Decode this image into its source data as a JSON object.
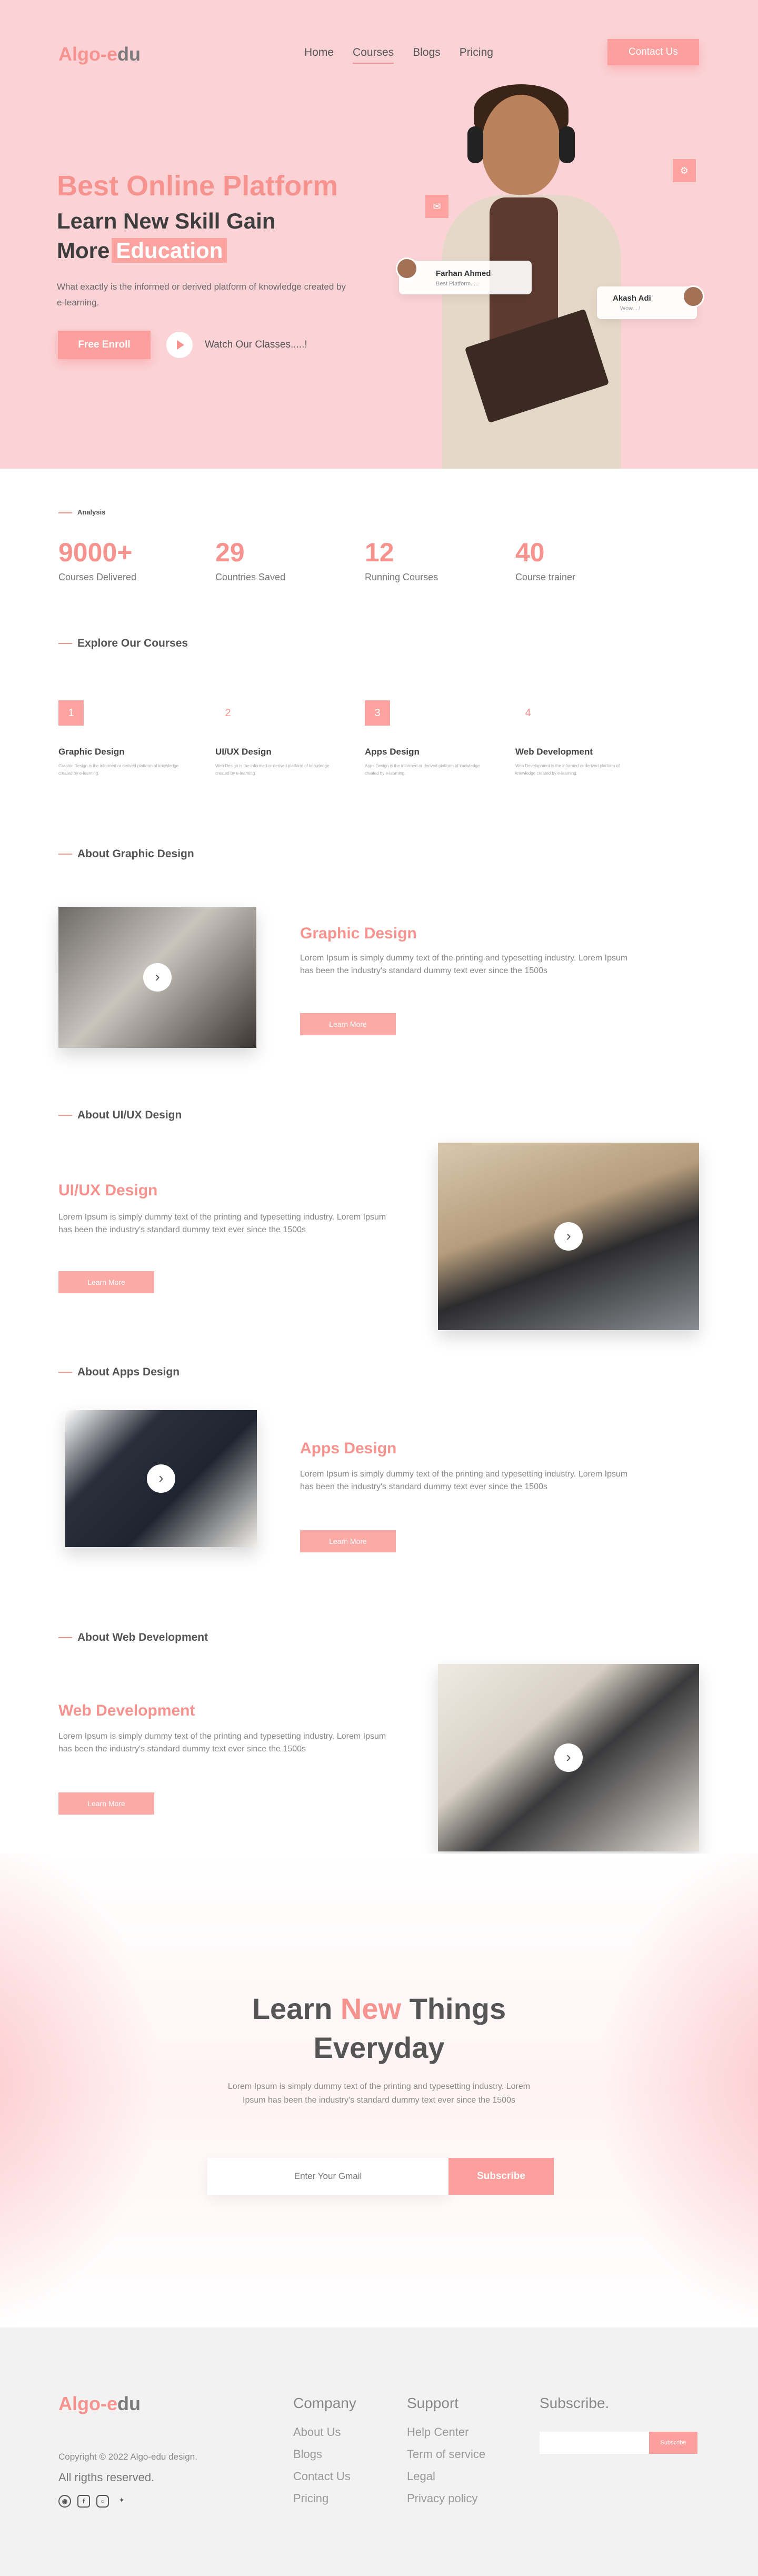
{
  "brand": {
    "logo_part1": "Algo-e",
    "logo_part2": "du"
  },
  "nav": {
    "items": [
      "Home",
      "Courses",
      "Blogs",
      "Pricing"
    ],
    "active": "Courses",
    "contact_button": "Contact Us"
  },
  "hero": {
    "line1": "Best Online Platform",
    "line2": "Learn New Skill Gain",
    "line3_prefix": "More",
    "line3_highlight": "Education",
    "description": "What exactly is the informed or derived platform of knowledge created by e-learning.",
    "enroll_button": "Free Enroll",
    "watch_label": "Watch Our Classes.....!",
    "card1": {
      "name": "Farhan Ahmed",
      "subtitle": "Best Platform....."
    },
    "card2": {
      "name": "Akash Adi",
      "subtitle": "Wow....!"
    }
  },
  "analysis": {
    "heading": "Analysis",
    "stats": [
      {
        "value": "9000+",
        "label": "Courses Delivered"
      },
      {
        "value": "29",
        "label": "Countries Saved"
      },
      {
        "value": "12",
        "label": "Running Courses"
      },
      {
        "value": "40",
        "label": "Course trainer"
      }
    ]
  },
  "courses": {
    "heading": "Explore Our Courses",
    "items": [
      {
        "num": "1",
        "title": "Graphic Design",
        "desc": "Graphic Design is the informed or derived platform of knowledge created by e-learning."
      },
      {
        "num": "2",
        "title": "UI/UX Design",
        "desc": "Web Design is the informed or derived platform of knowledge created by e-learning."
      },
      {
        "num": "3",
        "title": "Apps Design",
        "desc": "Apps Design is the informed or derived platform of knowledge created by e-learning."
      },
      {
        "num": "4",
        "title": "Web Development",
        "desc": "Web Development is the informed or derived platform of knowledge created by e-learning."
      }
    ]
  },
  "about": [
    {
      "heading": "About Graphic Design",
      "title": "Graphic Design",
      "text": "Lorem Ipsum is simply dummy text of the printing and typesetting industry. Lorem Ipsum has been the industry's standard dummy text ever since the 1500s",
      "button": "Learn More"
    },
    {
      "heading": "About UI/UX Design",
      "title": "UI/UX Design",
      "text": "Lorem Ipsum is simply dummy text of the printing and typesetting industry. Lorem Ipsum has been the industry's standard dummy text ever since the 1500s",
      "button": "Learn More"
    },
    {
      "heading": "About Apps Design",
      "title": "Apps Design",
      "text": "Lorem Ipsum is simply dummy text of the printing and typesetting industry. Lorem Ipsum has been the industry's standard dummy text ever since the 1500s",
      "button": "Learn More"
    },
    {
      "heading": "About Web Development",
      "title": "Web Development",
      "text": "Lorem Ipsum is simply dummy text of the printing and typesetting industry. Lorem Ipsum has been the industry's standard dummy text ever since the 1500s",
      "button": "Learn More"
    }
  ],
  "cta": {
    "title_learn": "Learn",
    "title_new": "New",
    "title_things": "Things",
    "title_line2": "Everyday",
    "text": "Lorem Ipsum is simply dummy text of the printing and typesetting industry. Lorem Ipsum has been the industry's standard dummy text ever since the 1500s",
    "email_placeholder": "Enter Your Gmail",
    "subscribe_button": "Subscribe"
  },
  "footer": {
    "copyright": "Copyright © 2022 Algo-edu design.",
    "rights": "All rigths reserved.",
    "social_icons": [
      "github-icon",
      "facebook-icon",
      "instagram-icon",
      "twitter-icon"
    ],
    "company": {
      "heading": "Company",
      "links": [
        "About Us",
        "Blogs",
        "Contact Us",
        "Pricing"
      ]
    },
    "support": {
      "heading": "Support",
      "links": [
        "Help Center",
        "Term of service",
        "Legal",
        "Privacy policy"
      ]
    },
    "subscribe": {
      "heading": "Subscribe.",
      "button": "Subscribe"
    }
  },
  "colors": {
    "accent": "#f7938f",
    "hero_bg": "#fbd3d6",
    "footer_bg": "#f3f2f2"
  }
}
